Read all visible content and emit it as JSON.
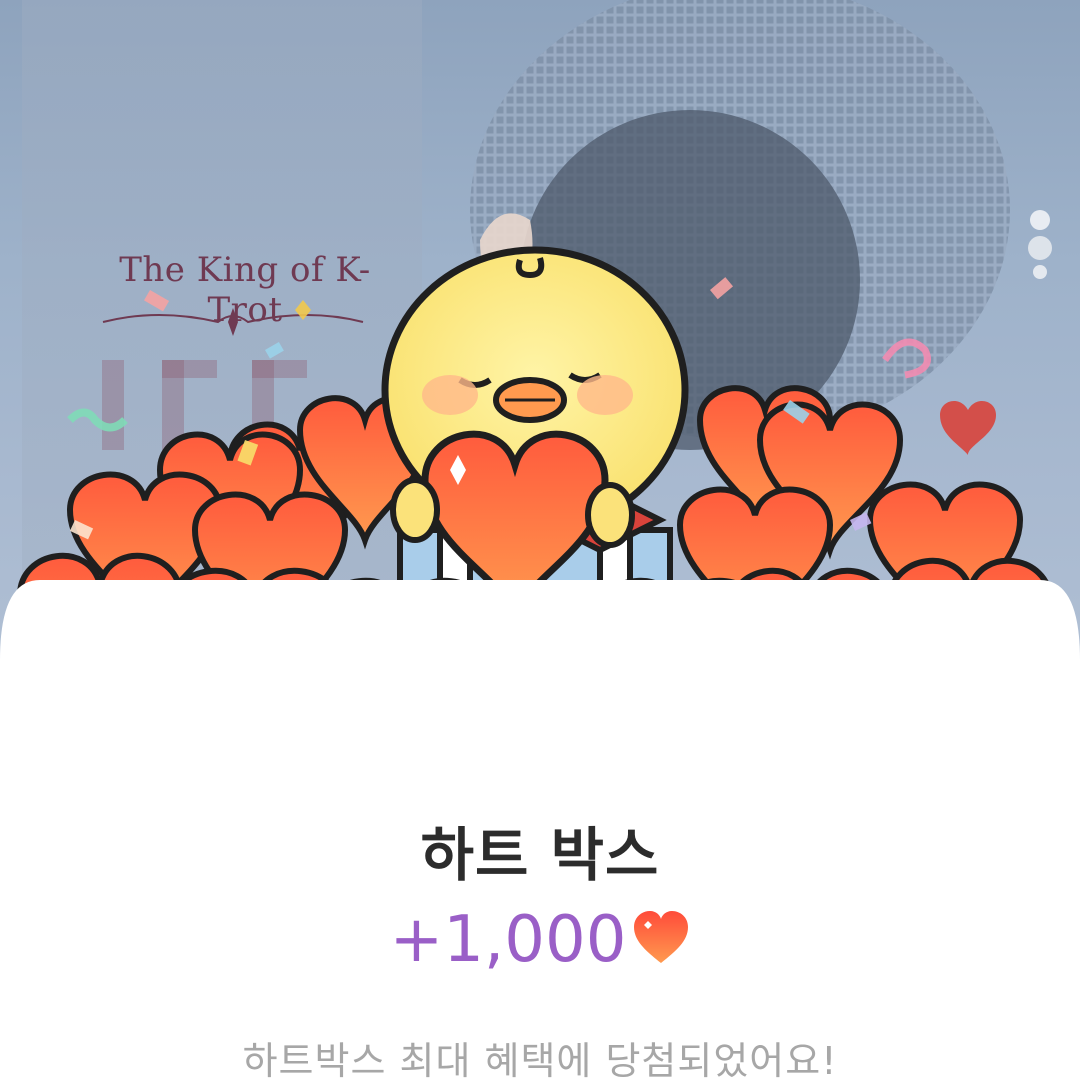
{
  "background": {
    "poster_title": "The King of K-Trot",
    "image_name": "idol-photo-background"
  },
  "illustration": {
    "character": "chick-holding-heart",
    "items": "heart-box"
  },
  "card": {
    "title": "하트 박스",
    "reward_value": "+1,000",
    "reward_icon": "heart-icon",
    "message": "하트박스 최대 혜택에 당첨되었어요!"
  },
  "colors": {
    "reward": "#9a5fc7",
    "heart": "#ff5a3c",
    "title": "#2c2c2c",
    "message": "#a7a7a7"
  }
}
